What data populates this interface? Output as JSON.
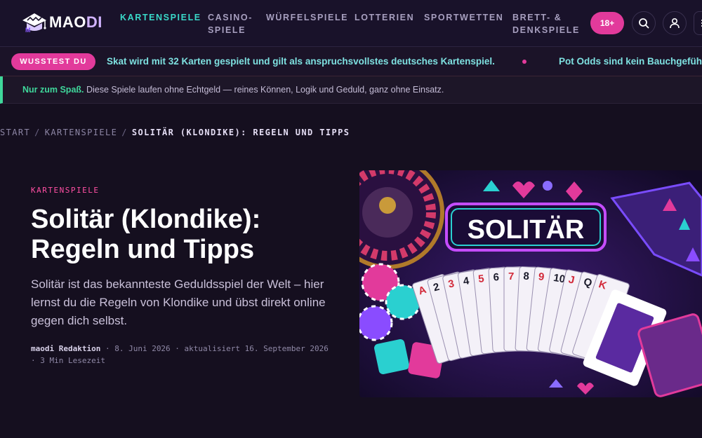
{
  "brand": {
    "name_part1": "MAO",
    "name_part2": "DI"
  },
  "nav": {
    "items": [
      {
        "label": "KARTENSPIELE",
        "active": true
      },
      {
        "label": "CASINO-",
        "label2": "SPIELE"
      },
      {
        "label": "WÜRFELSPIELE"
      },
      {
        "label": "LOTTERIEN"
      },
      {
        "label": "SPORTWETTEN"
      },
      {
        "label": "BRETT- &",
        "label2": "DENKSPIELE"
      }
    ],
    "age_badge": "18+",
    "icons": [
      "search-icon",
      "user-icon",
      "menu-icon"
    ]
  },
  "ticker": {
    "pill": "WUSSTEST DU",
    "items": [
      "Skat wird mit 32 Karten gespielt und gilt als anspruchsvollstes deutsches Kartenspiel.",
      "Pot Odds sind kein Bauchgefühl"
    ]
  },
  "notice": {
    "strong": "Nur zum Spaß.",
    "text": " Diese Spiele laufen ohne Echtgeld — reines Können, Logik und Geduld, ganz ohne Einsatz."
  },
  "breadcrumb": {
    "items": [
      "START",
      "KARTENSPIELE"
    ],
    "current": "SOLITÄR (KLONDIKE): REGELN UND TIPPS",
    "separator": "/"
  },
  "article": {
    "category": "KARTENSPIELE",
    "title_line1": "Solitär (Klondike):",
    "title_line2": "Regeln und Tipps",
    "lead": "Solitär ist das bekannteste Geduldsspiel der Welt – hier lernst du die Regeln von Klondike und übst direkt online gegen dich selbst.",
    "author": "maodi Redaktion",
    "meta_rest": " · 8. Juni 2026 · aktualisiert 16. September 2026 · 3 Min Lesezeit"
  },
  "hero_image": {
    "sign_text": "SOLITÄR",
    "card_ranks": [
      "A",
      "2",
      "3",
      "4",
      "5",
      "6",
      "7",
      "8",
      "9",
      "10",
      "J",
      "Q",
      "K"
    ]
  },
  "colors": {
    "accent_teal": "#39d9c9",
    "accent_pink": "#e23a9b",
    "accent_green": "#3fd79b",
    "background": "#150f1f"
  }
}
